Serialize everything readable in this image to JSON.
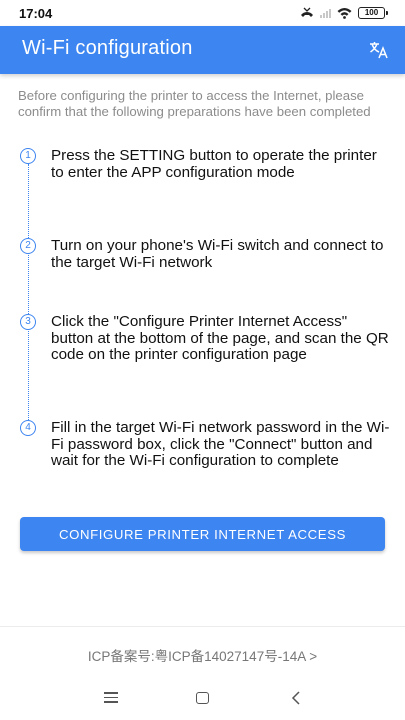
{
  "status_bar": {
    "time": "17:04",
    "battery": "100",
    "icons": [
      "missed-call-icon",
      "signal-icon",
      "wifi-icon",
      "battery-icon"
    ]
  },
  "app_bar": {
    "title": "Wi-Fi configuration",
    "action_icon": "translate-icon"
  },
  "intro": "Before configuring the printer to access the Internet, please confirm that the following preparations have been completed",
  "steps": [
    {
      "number": "1",
      "text": "Press the SETTING button to operate the printer to enter the APP configuration mode"
    },
    {
      "number": "2",
      "text": "Turn on your phone's Wi-Fi switch and connect to the target Wi-Fi network"
    },
    {
      "number": "3",
      "text": "Click the \"Configure Printer Internet Access\" button at the bottom of the page, and scan the QR code on the printer configuration page"
    },
    {
      "number": "4",
      "text": "Fill in the target Wi-Fi network password in the Wi-Fi password box, click the \"Connect\" button and wait for the Wi-Fi configuration to complete"
    }
  ],
  "configure_button_label": "CONFIGURE PRINTER INTERNET ACCESS",
  "footer": {
    "icp": "ICP备案号:粤ICP备14027147号-14A >"
  },
  "nav_bar": {
    "icons": [
      "menu-icon",
      "home-icon",
      "back-icon"
    ]
  },
  "colors": {
    "accent": "#3d85f0",
    "intro_text": "#8c8c8c",
    "footer_text": "#777777"
  }
}
